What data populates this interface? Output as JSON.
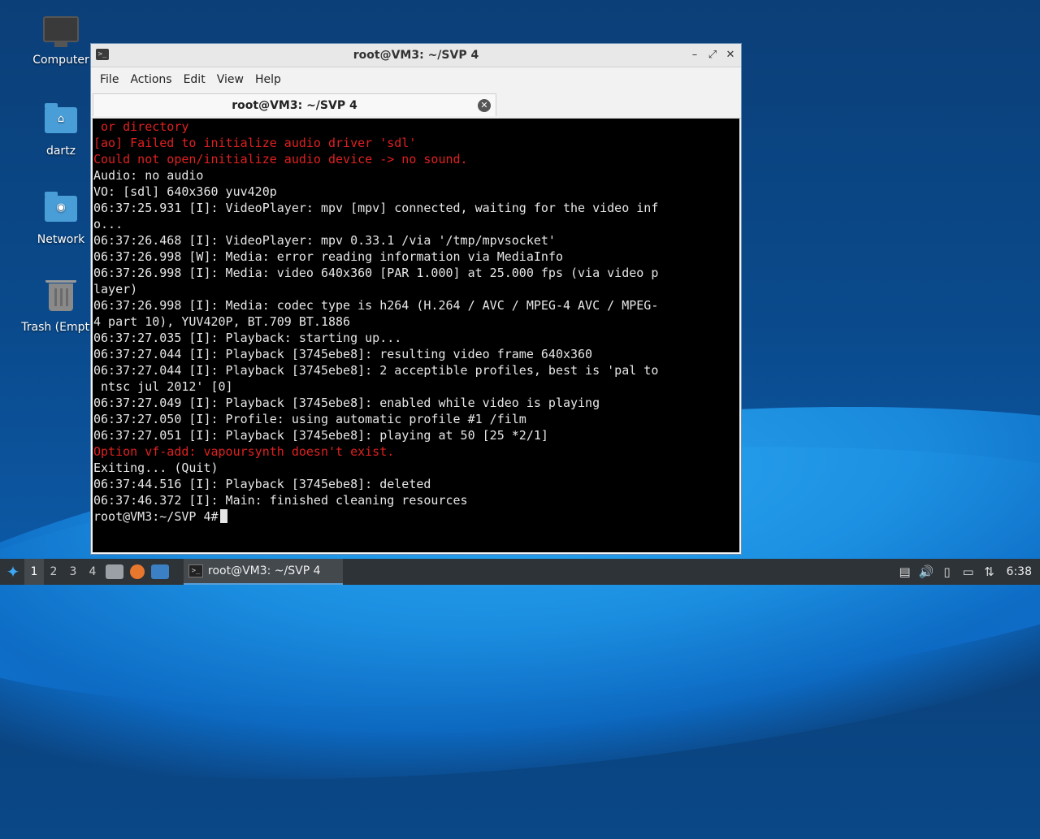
{
  "desktop": {
    "icons": [
      {
        "label": "Computer",
        "icon": "computer-icon"
      },
      {
        "label": "dartz",
        "icon": "home-folder-icon"
      },
      {
        "label": "Network",
        "icon": "network-folder-icon"
      },
      {
        "label": "Trash (Empty)",
        "icon": "trash-icon"
      }
    ]
  },
  "window": {
    "title": "root@VM3: ~/SVP 4",
    "controls": {
      "minimize": "–",
      "maximize": "⤢",
      "close": "✕"
    },
    "menu": [
      "File",
      "Actions",
      "Edit",
      "View",
      "Help"
    ],
    "tab": {
      "label": "root@VM3: ~/SVP 4",
      "close": "✕"
    }
  },
  "terminal": {
    "lines": [
      {
        "text": " or directory",
        "err": true
      },
      {
        "text": "[ao] Failed to initialize audio driver 'sdl'",
        "err": true
      },
      {
        "text": "Could not open/initialize audio device -> no sound.",
        "err": true
      },
      {
        "text": "Audio: no audio",
        "err": false
      },
      {
        "text": "VO: [sdl] 640x360 yuv420p",
        "err": false
      },
      {
        "text": "06:37:25.931 [I]: VideoPlayer: mpv [mpv] connected, waiting for the video inf",
        "err": false
      },
      {
        "text": "o...",
        "err": false
      },
      {
        "text": "06:37:26.468 [I]: VideoPlayer: mpv 0.33.1 /via '/tmp/mpvsocket'",
        "err": false
      },
      {
        "text": "06:37:26.998 [W]: Media: error reading information via MediaInfo",
        "err": false
      },
      {
        "text": "06:37:26.998 [I]: Media: video 640x360 [PAR 1.000] at 25.000 fps (via video p",
        "err": false
      },
      {
        "text": "layer)",
        "err": false
      },
      {
        "text": "06:37:26.998 [I]: Media: codec type is h264 (H.264 / AVC / MPEG-4 AVC / MPEG-",
        "err": false
      },
      {
        "text": "4 part 10), YUV420P, BT.709 BT.1886",
        "err": false
      },
      {
        "text": "06:37:27.035 [I]: Playback: starting up...",
        "err": false
      },
      {
        "text": "06:37:27.044 [I]: Playback [3745ebe8]: resulting video frame 640x360",
        "err": false
      },
      {
        "text": "06:37:27.044 [I]: Playback [3745ebe8]: 2 acceptible profiles, best is 'pal to",
        "err": false
      },
      {
        "text": " ntsc jul 2012' [0]",
        "err": false
      },
      {
        "text": "06:37:27.049 [I]: Playback [3745ebe8]: enabled while video is playing",
        "err": false
      },
      {
        "text": "06:37:27.050 [I]: Profile: using automatic profile #1 /film",
        "err": false
      },
      {
        "text": "06:37:27.051 [I]: Playback [3745ebe8]: playing at 50 [25 *2/1]",
        "err": false
      },
      {
        "text": "Option vf-add: vapoursynth doesn't exist.",
        "err": true
      },
      {
        "text": "",
        "err": false
      },
      {
        "text": "Exiting... (Quit)",
        "err": false
      },
      {
        "text": "06:37:44.516 [I]: Playback [3745ebe8]: deleted",
        "err": false
      },
      {
        "text": "06:37:46.372 [I]: Main: finished cleaning resources",
        "err": false
      }
    ],
    "prompt": "root@VM3:~/SVP 4#"
  },
  "taskbar": {
    "workspaces": [
      "1",
      "2",
      "3",
      "4"
    ],
    "active_workspace": "1",
    "task_label": "root@VM3: ~/SVP 4",
    "clock": "6:38"
  }
}
